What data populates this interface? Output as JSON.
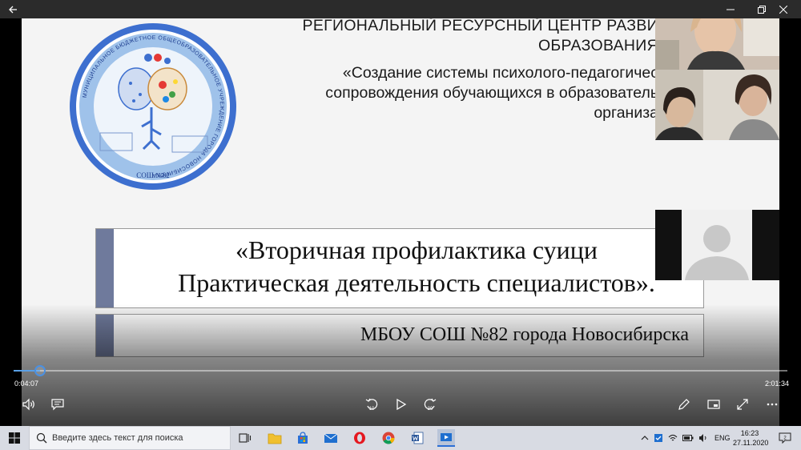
{
  "window": {
    "back_icon": "arrow-left-icon",
    "minimize_icon": "minimize-icon",
    "maximize_icon": "restore-icon",
    "close_icon": "close-icon"
  },
  "slide": {
    "logo_ring_text": "МУНИЦИПАЛЬНОЕ БЮДЖЕТНОЕ ОБЩЕОБРАЗОВАТЕЛЬНОЕ УЧРЕЖДЕНИЕ ГОРОДА НОВОСИБИРСКА",
    "logo_bottom_text": "СОШ №82",
    "header_title_line1": "РЕГИОНАЛЬНЫЙ РЕСУРСНЫЙ ЦЕНТР РАЗВИ",
    "header_title_line2": "ОБРАЗОВАНИЯ",
    "header_sub_line1": "«Создание системы психолого-педагогичес",
    "header_sub_line2": "сопровождения обучающихся в образователь",
    "header_sub_line3": "организа",
    "topic_line1": "«Вторичная профилактика суици",
    "topic_line2": "Практическая деятельность специалистов».",
    "school_line": "МБОУ СОШ №82 города Новосибирска"
  },
  "player": {
    "current_time": "0:04:07",
    "total_time": "2:01:34",
    "progress": 0.034,
    "skip_back_label": "10",
    "skip_forward_label": "30"
  },
  "taskbar": {
    "search_placeholder": "Введите здесь текст для поиска",
    "lang": "ENG",
    "time": "16:23",
    "date": "27.11.2020",
    "notification_count": "2"
  },
  "colors": {
    "accent_bar": "#6f7a9c",
    "progress": "#4a90e2",
    "logo_blue": "#3d6fcf"
  }
}
